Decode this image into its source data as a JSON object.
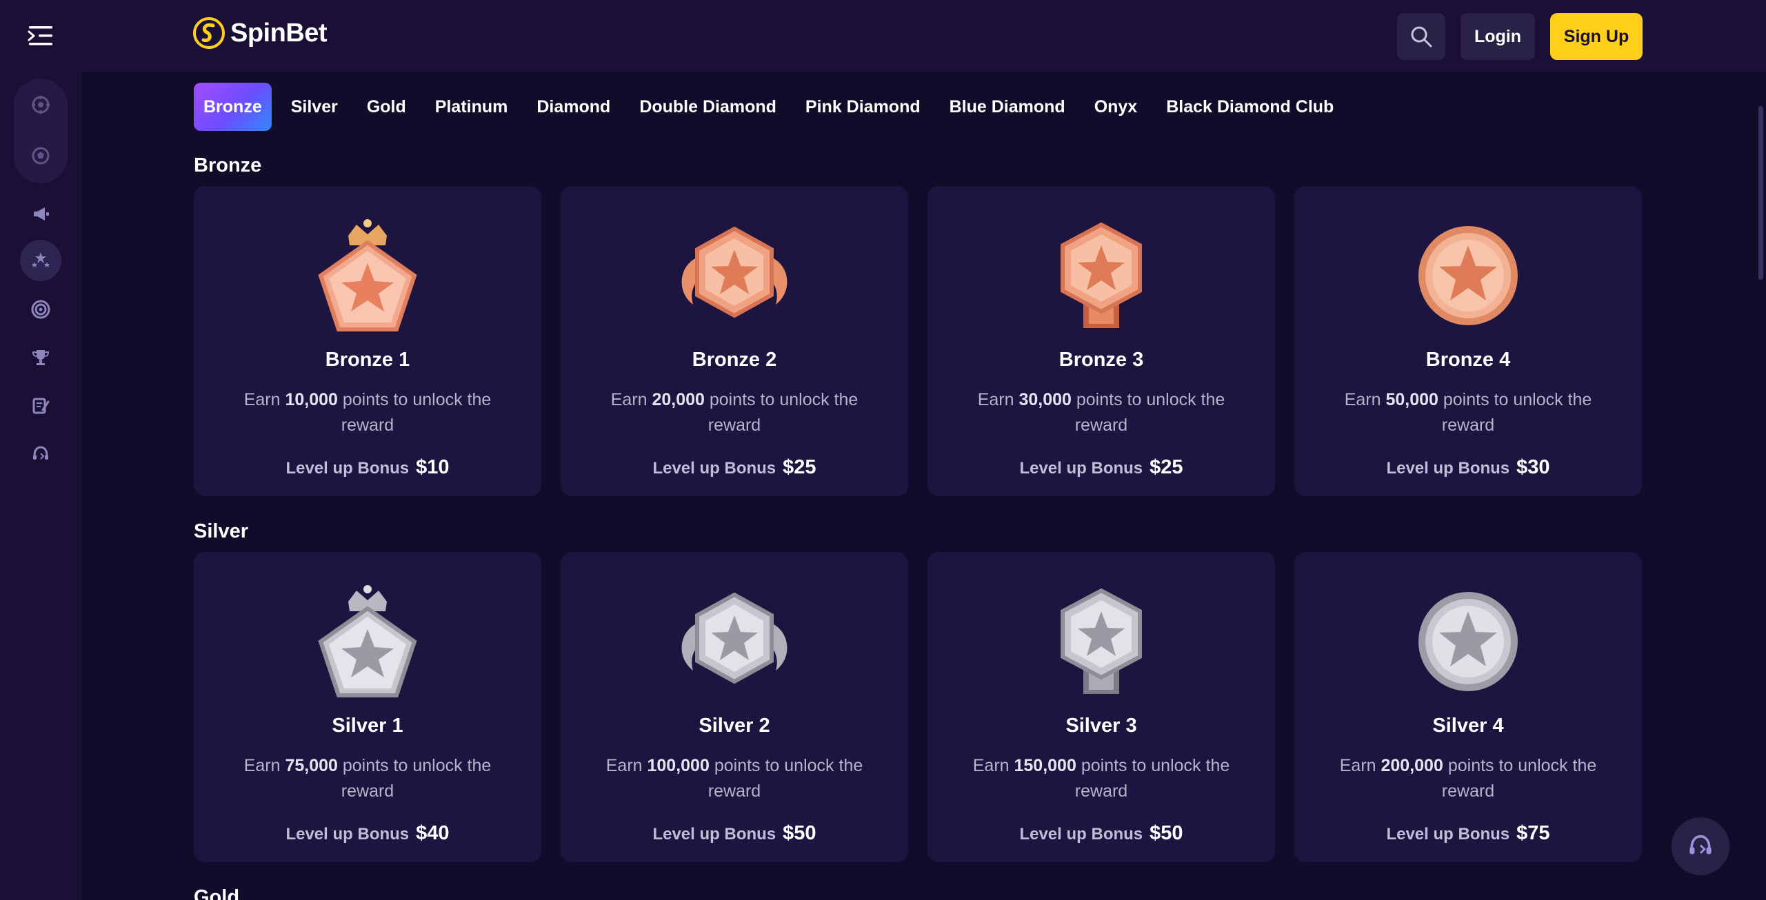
{
  "header": {
    "brand": "SpinBet",
    "login_label": "Login",
    "signup_label": "Sign Up",
    "icons": [
      "menu-icon",
      "search-icon"
    ],
    "accent": "#ffcf1a"
  },
  "sidebar": {
    "icons": [
      "casino-chip-icon",
      "sports-ball-icon",
      "megaphone-icon",
      "stars-icon",
      "target-icon",
      "trophy-icon",
      "notes-icon",
      "support-headset-icon"
    ]
  },
  "tabs": [
    "Bronze",
    "Silver",
    "Gold",
    "Platinum",
    "Diamond",
    "Double Diamond",
    "Pink Diamond",
    "Blue Diamond",
    "Onyx",
    "Black Diamond Club"
  ],
  "active_tab": "Bronze",
  "sections": [
    {
      "title": "Bronze",
      "color": "#e89068",
      "cards": [
        {
          "name": "Bronze 1",
          "earn": "Earn",
          "points": "10,000",
          "desc": "points to unlock the reward",
          "bonus_label": "Level up Bonus",
          "bonus": "$10",
          "badge": "crown-pentagon-badge"
        },
        {
          "name": "Bronze 2",
          "earn": "Earn",
          "points": "20,000",
          "desc": "points to unlock the reward",
          "bonus_label": "Level up Bonus",
          "bonus": "$25",
          "badge": "winged-hexagon-badge"
        },
        {
          "name": "Bronze 3",
          "earn": "Earn",
          "points": "30,000",
          "desc": "points to unlock the reward",
          "bonus_label": "Level up Bonus",
          "bonus": "$25",
          "badge": "ribbon-hexagon-badge"
        },
        {
          "name": "Bronze 4",
          "earn": "Earn",
          "points": "50,000",
          "desc": "points to unlock the reward",
          "bonus_label": "Level up Bonus",
          "bonus": "$30",
          "badge": "round-medal-badge"
        }
      ]
    },
    {
      "title": "Silver",
      "color": "#b8b8c0",
      "cards": [
        {
          "name": "Silver 1",
          "earn": "Earn",
          "points": "75,000",
          "desc": "points to unlock the reward",
          "bonus_label": "Level up Bonus",
          "bonus": "$40",
          "badge": "crown-pentagon-badge"
        },
        {
          "name": "Silver 2",
          "earn": "Earn",
          "points": "100,000",
          "desc": "points to unlock the reward",
          "bonus_label": "Level up Bonus",
          "bonus": "$50",
          "badge": "winged-hexagon-badge"
        },
        {
          "name": "Silver 3",
          "earn": "Earn",
          "points": "150,000",
          "desc": "points to unlock the reward",
          "bonus_label": "Level up Bonus",
          "bonus": "$50",
          "badge": "ribbon-hexagon-badge"
        },
        {
          "name": "Silver 4",
          "earn": "Earn",
          "points": "200,000",
          "desc": "points to unlock the reward",
          "bonus_label": "Level up Bonus",
          "bonus": "$75",
          "badge": "round-medal-badge"
        }
      ]
    },
    {
      "title": "Gold",
      "color": "#e6b84a",
      "cards": []
    }
  ]
}
